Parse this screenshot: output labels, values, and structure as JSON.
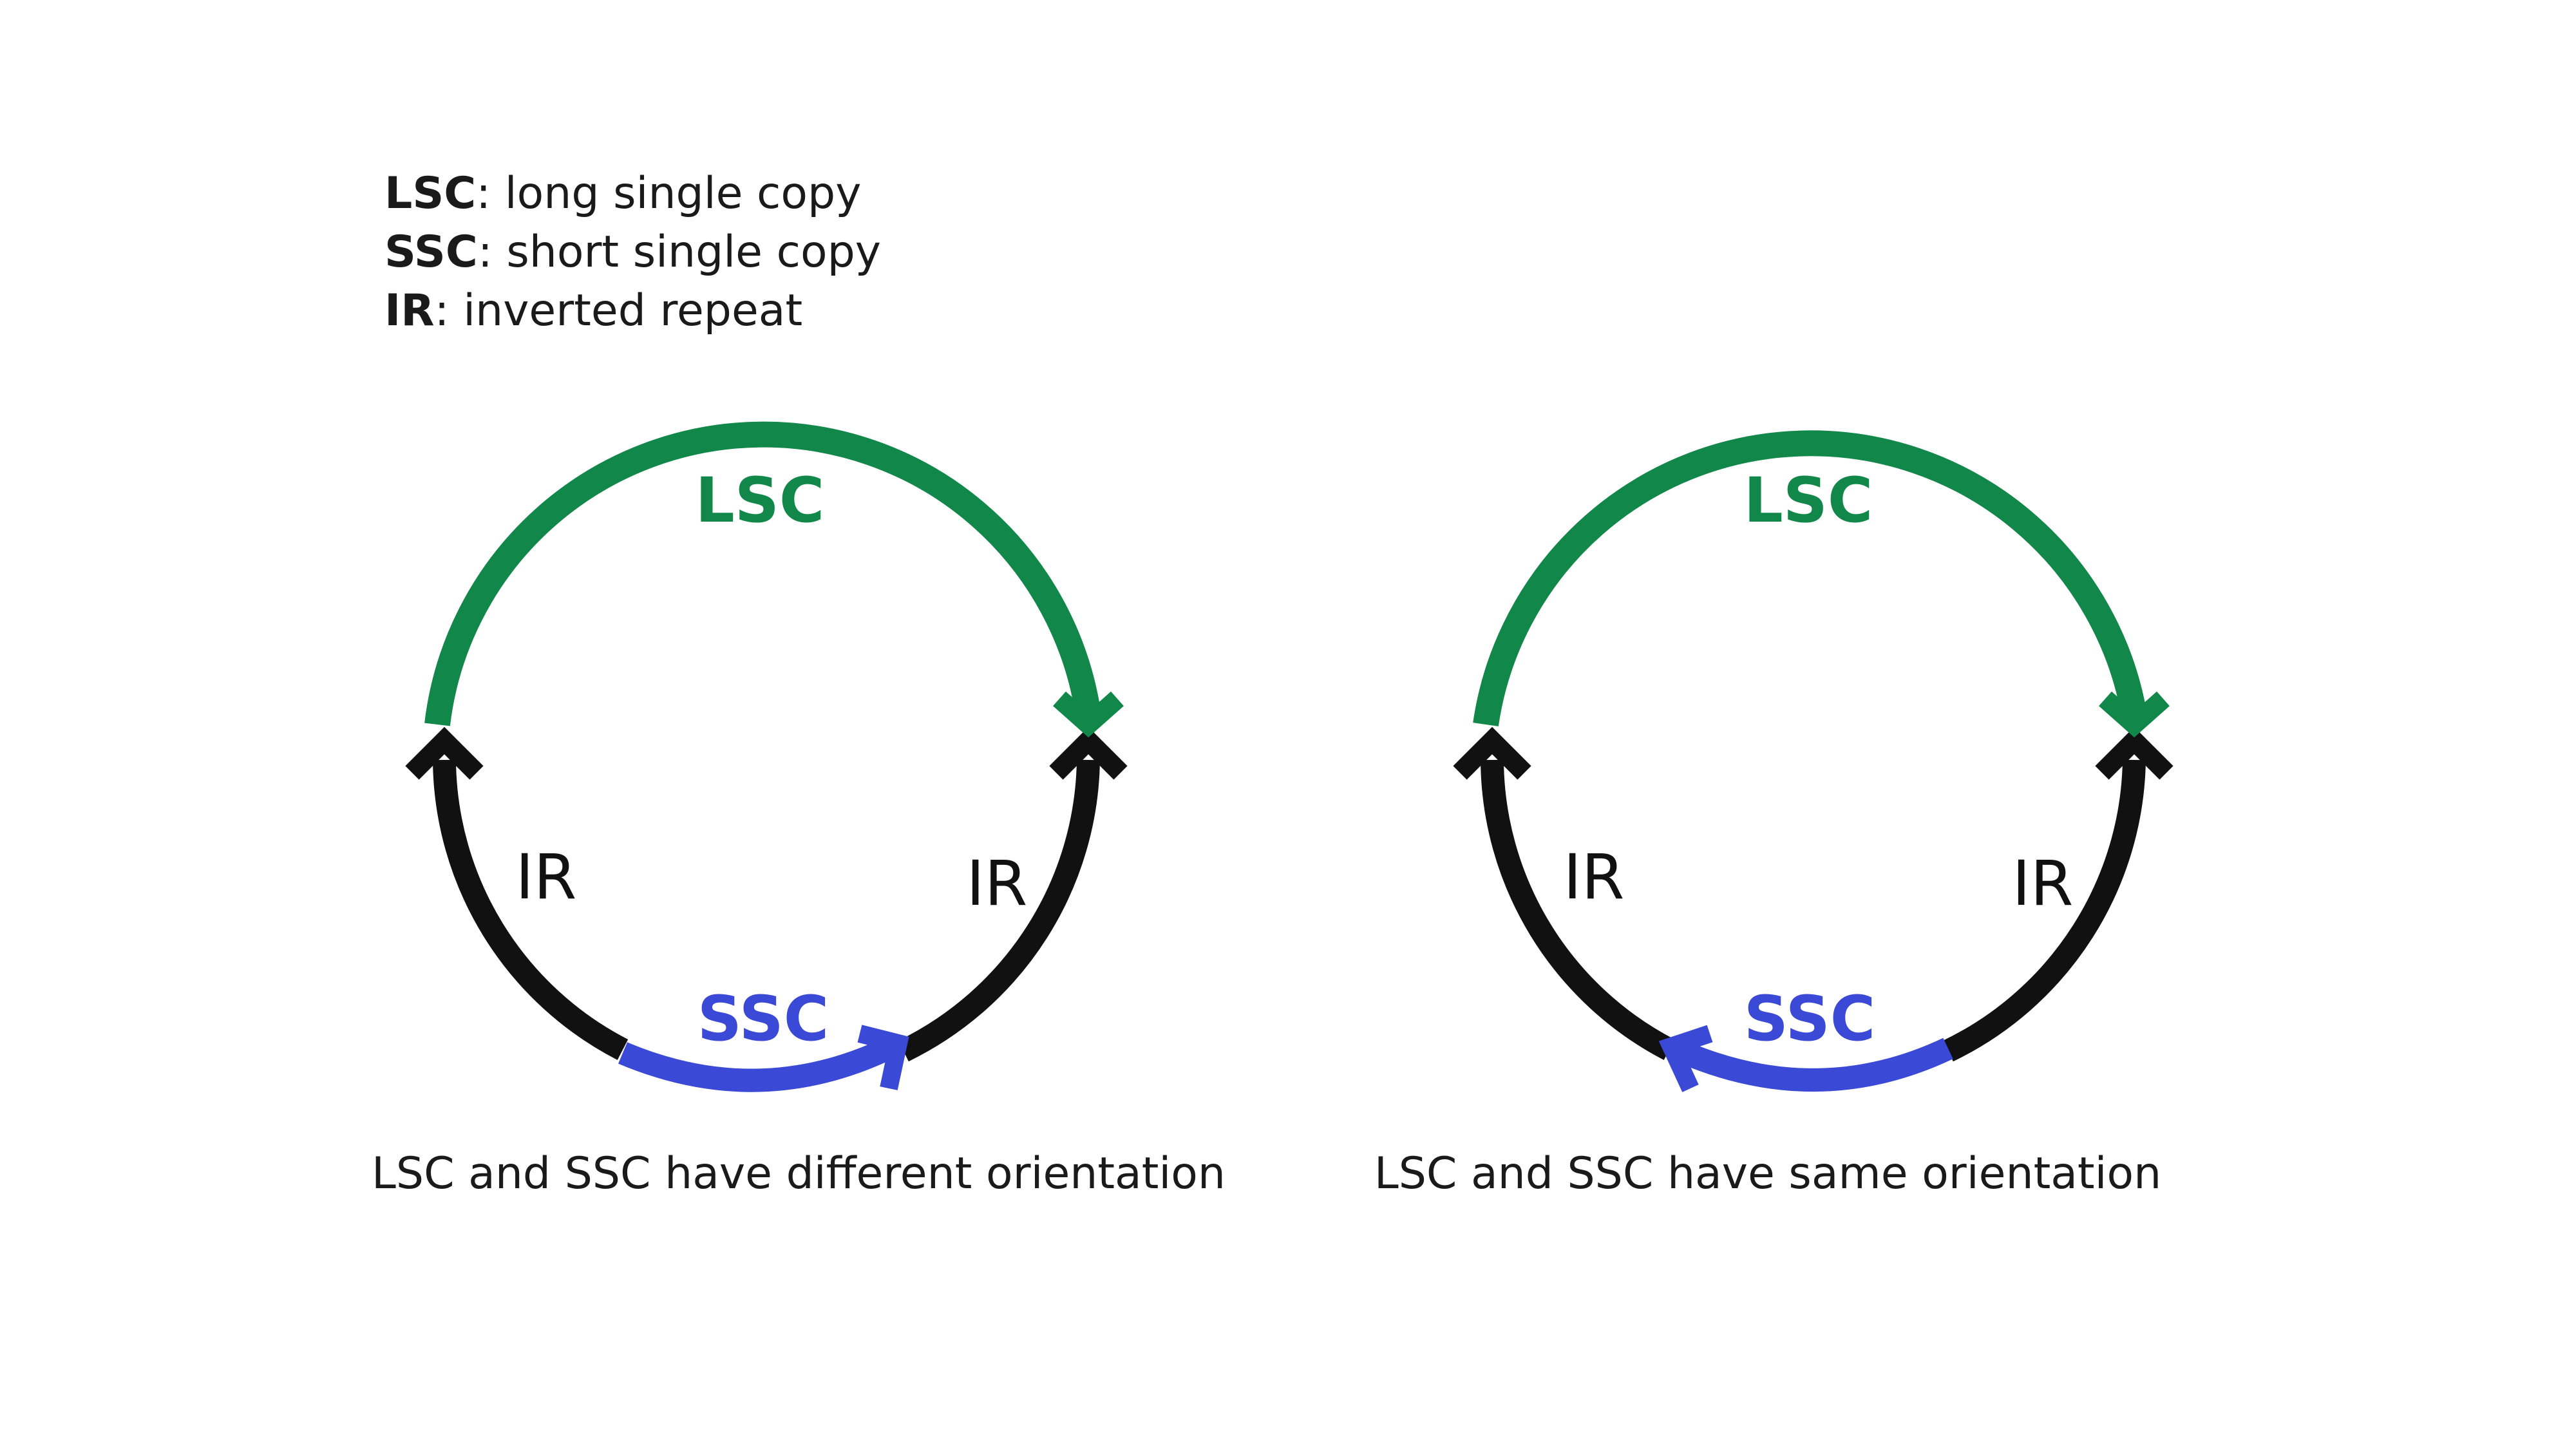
{
  "legend": {
    "items": [
      {
        "abbr": "LSC",
        "desc": ": long single copy"
      },
      {
        "abbr": "SSC",
        "desc": ": short single copy"
      },
      {
        "abbr": "IR",
        "desc": ": inverted repeat"
      }
    ]
  },
  "colors": {
    "lsc": "#12874a",
    "ssc": "#3a49d6",
    "ir": "#111111"
  },
  "diagrams": [
    {
      "lsc_label": "LSC",
      "ssc_label": "SSC",
      "ir_left_label": "IR",
      "ir_right_label": "IR",
      "ssc_arrow_direction": "clockwise",
      "caption": "LSC and SSC have different orientation"
    },
    {
      "lsc_label": "LSC",
      "ssc_label": "SSC",
      "ir_left_label": "IR",
      "ir_right_label": "IR",
      "ssc_arrow_direction": "counterclockwise",
      "caption": "LSC and SSC have same orientation"
    }
  ]
}
